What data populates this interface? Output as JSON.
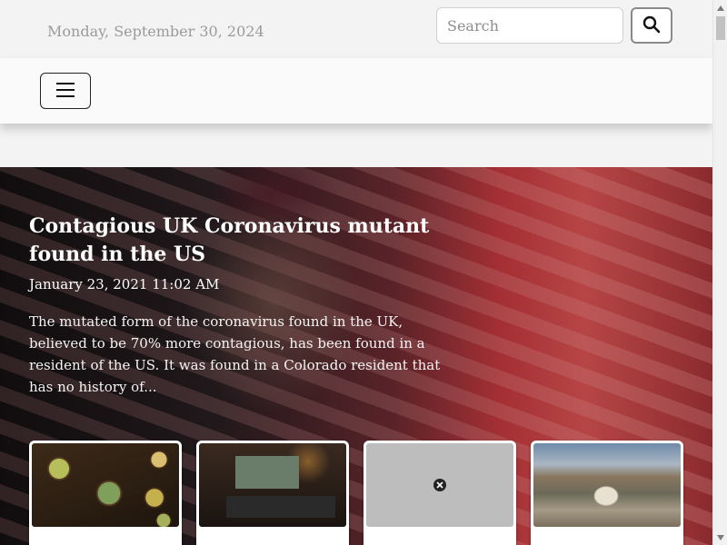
{
  "header": {
    "date": "Monday, September 30, 2024",
    "search_placeholder": "Search",
    "search_icon": "search-icon"
  },
  "nav": {
    "menu_icon": "hamburger-menu-icon"
  },
  "featured": {
    "title": "Contagious UK Coronavirus mutant found in the US",
    "date": "January 23, 2021 11:02 AM",
    "summary": "The mutated form of the coronavirus found in the UK, believed to be 70% more contagious, has been found in a resident of the US. It was found in a Colorado resident that has no history of..."
  },
  "cards": [
    {
      "image": "herbal-powders-image"
    },
    {
      "image": "tablet-device-image"
    },
    {
      "image": "broken-image-icon"
    },
    {
      "image": "city-dome-image"
    }
  ],
  "colors": {
    "accent_red": "#c44a4a",
    "text_muted": "#9a9a9a"
  }
}
